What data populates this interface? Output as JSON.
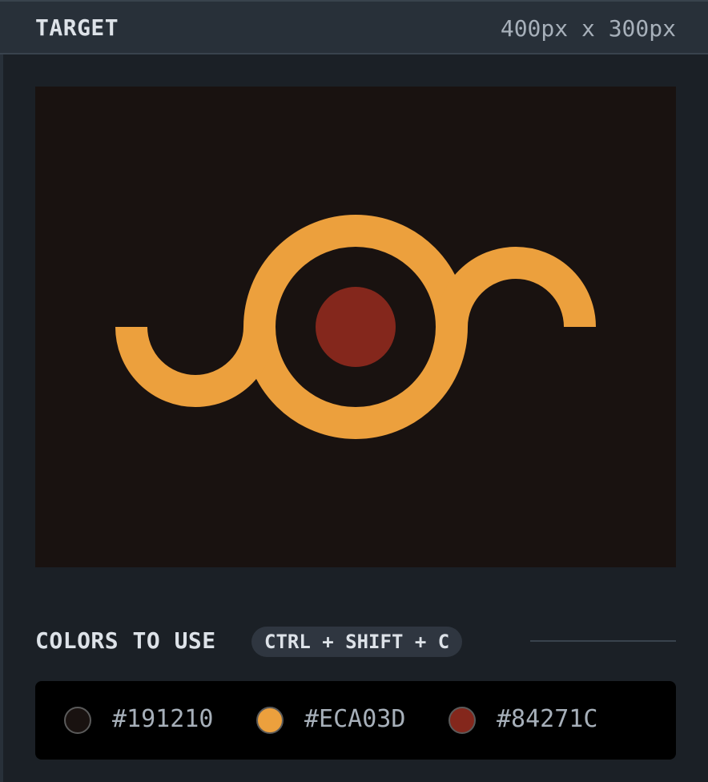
{
  "header": {
    "title": "TARGET",
    "dimensions": "400px x 300px"
  },
  "target": {
    "background_color": "#191210",
    "shape_color": "#ECA03D",
    "dot_color": "#84271C"
  },
  "colors_section": {
    "title": "COLORS TO USE",
    "shortcut": "CTRL + SHIFT + C",
    "swatches": [
      {
        "hex": "#191210",
        "color": "#191210"
      },
      {
        "hex": "#ECA03D",
        "color": "#ECA03D"
      },
      {
        "hex": "#84271C",
        "color": "#84271C"
      }
    ]
  }
}
